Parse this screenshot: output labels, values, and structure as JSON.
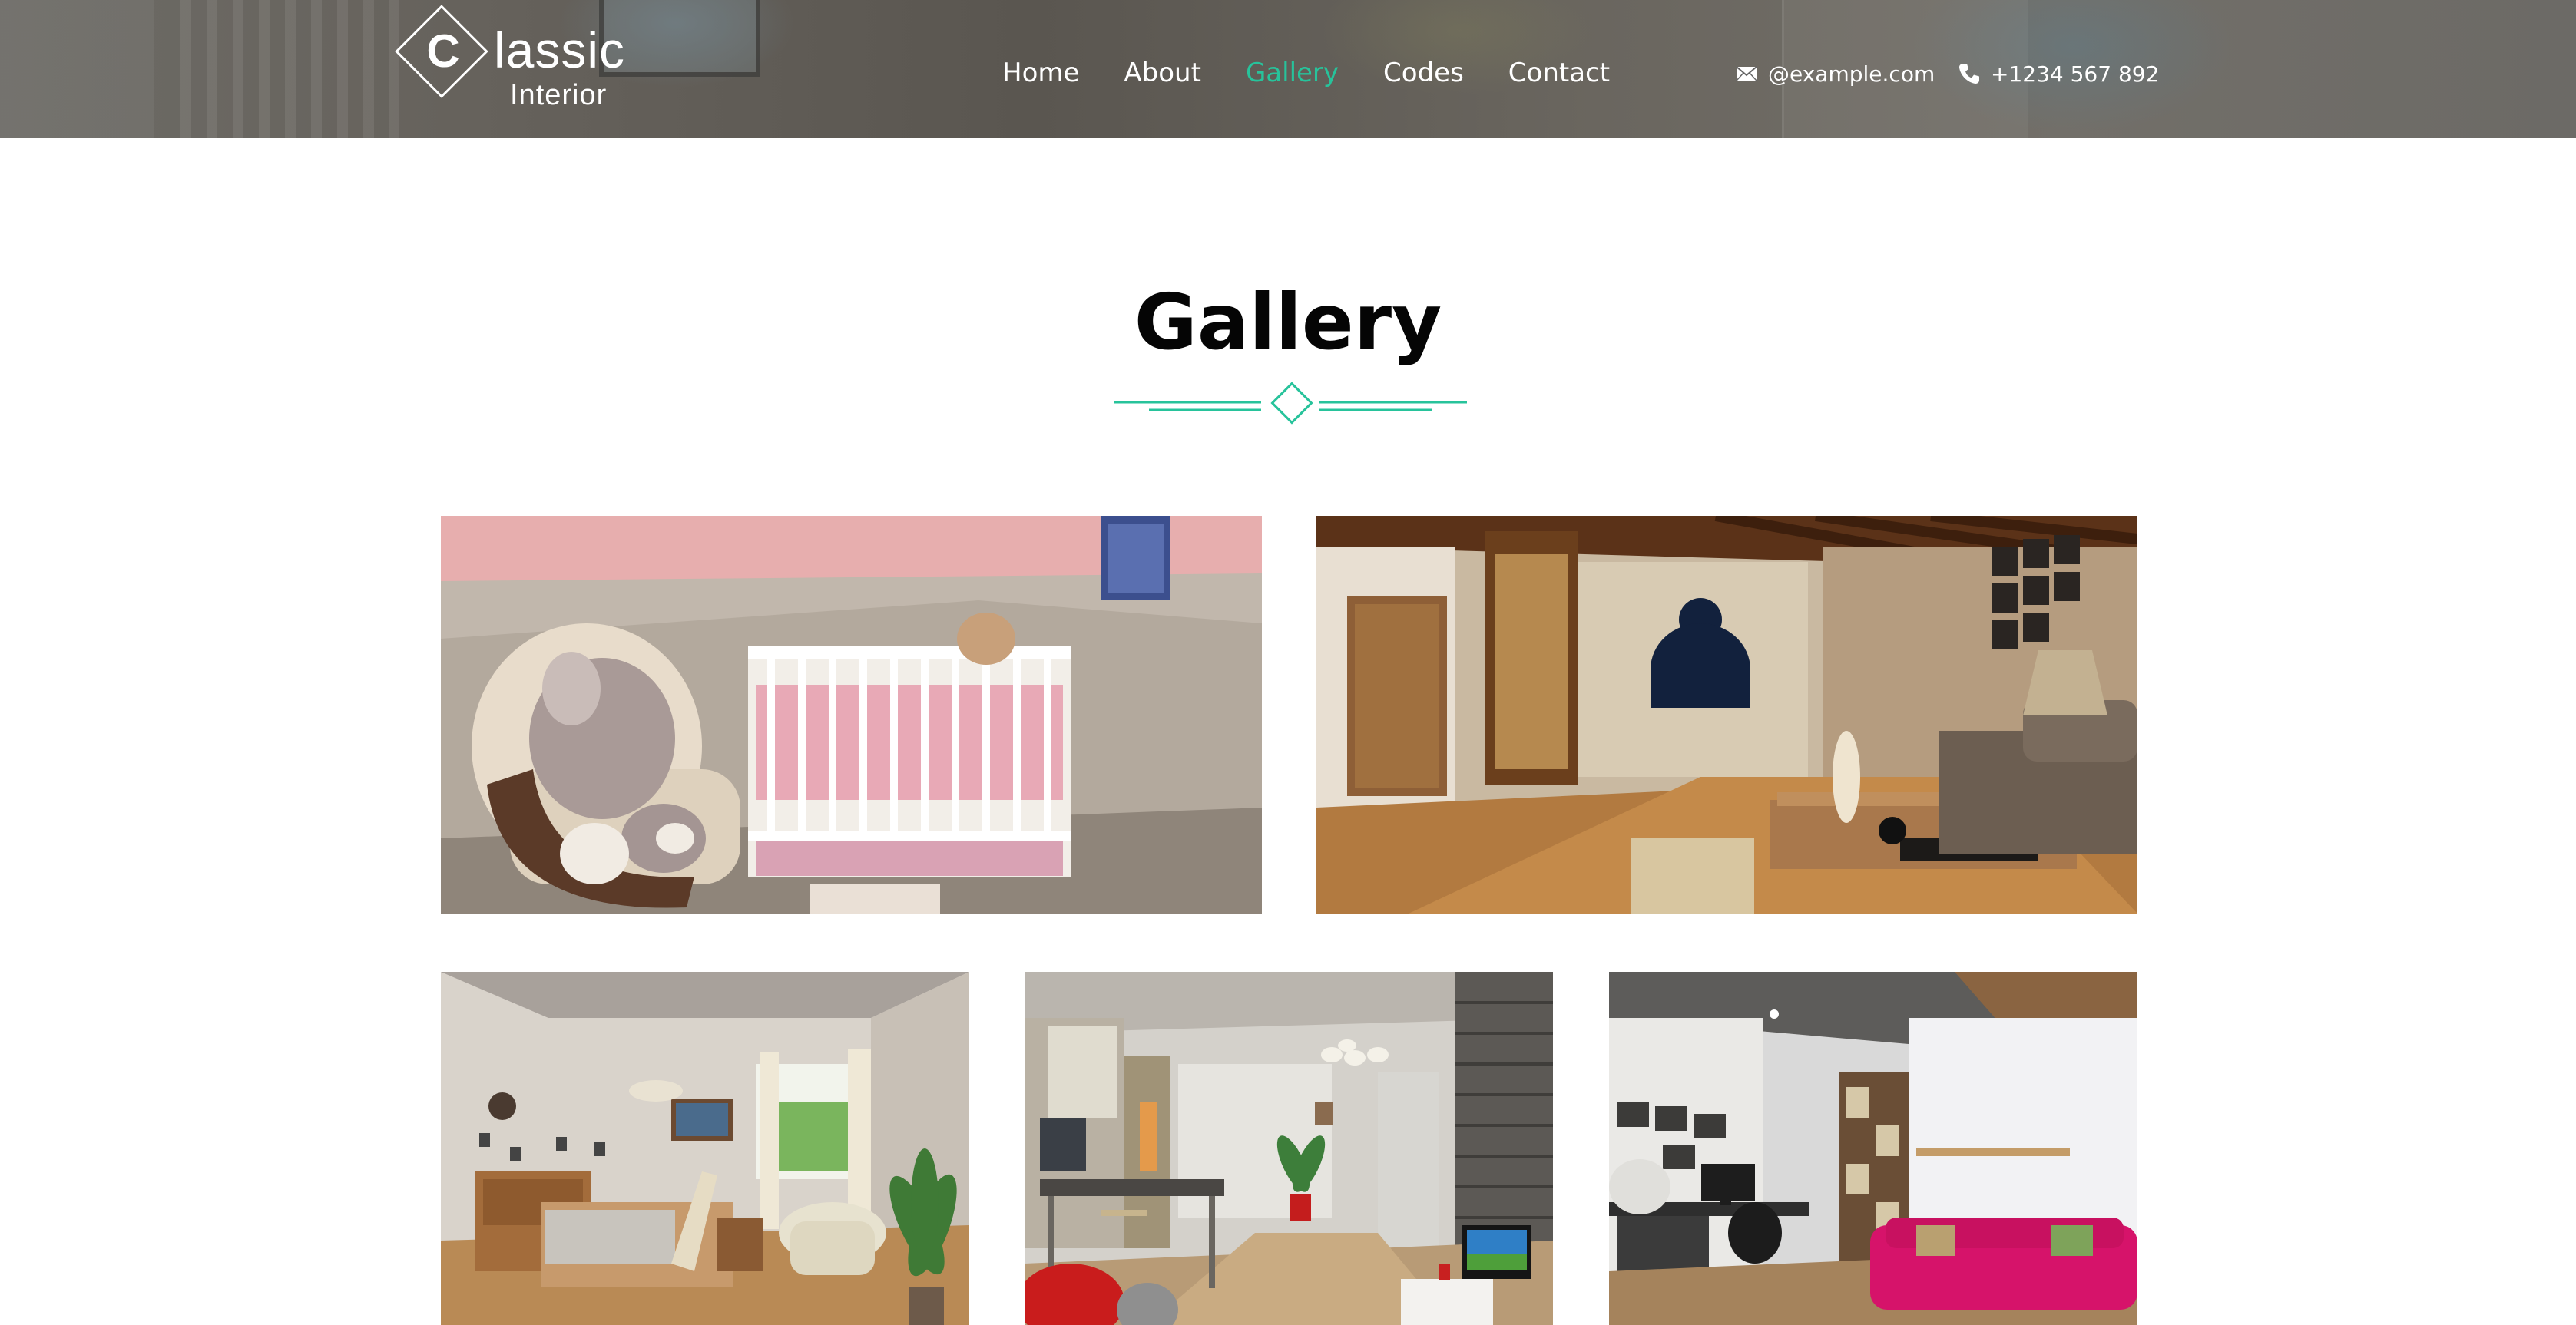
{
  "logo": {
    "initial": "C",
    "word": "lassic",
    "subtitle": "Interior"
  },
  "nav": {
    "items": [
      {
        "label": "Home",
        "active": false
      },
      {
        "label": "About",
        "active": false
      },
      {
        "label": "Gallery",
        "active": true
      },
      {
        "label": "Codes",
        "active": false
      },
      {
        "label": "Contact",
        "active": false
      }
    ]
  },
  "contact": {
    "email": "@example.com",
    "email_icon": "envelope-icon",
    "phone": "+1234 567 892",
    "phone_icon": "phone-icon"
  },
  "gallery": {
    "title": "Gallery",
    "accent_color": "#27c39b",
    "photos": [
      {
        "subject": "nursery-crib"
      },
      {
        "subject": "living-room-wood-floor"
      },
      {
        "subject": "bedroom-with-window"
      },
      {
        "subject": "kitchen-dining-hall"
      },
      {
        "subject": "study-with-pink-sofa"
      }
    ]
  }
}
